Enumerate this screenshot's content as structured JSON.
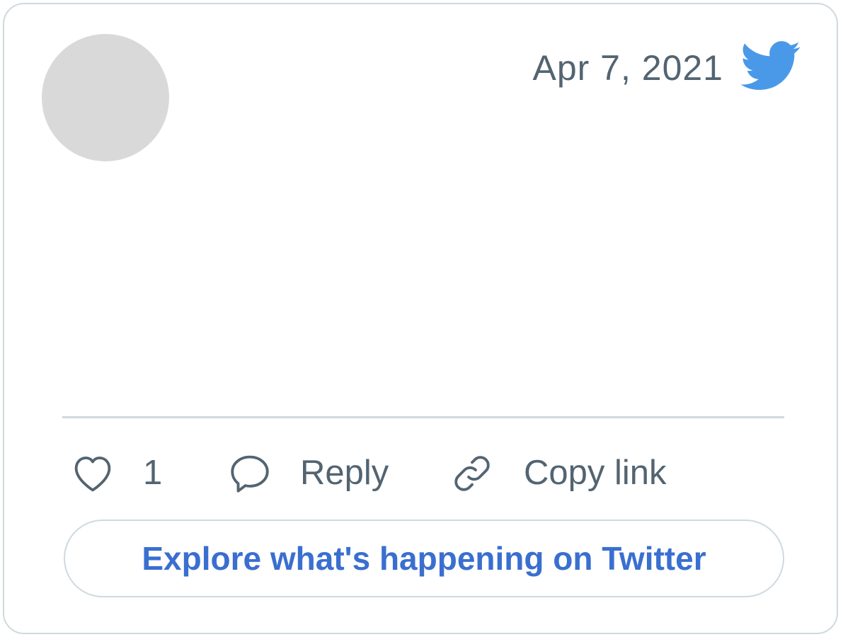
{
  "tweet": {
    "date": "Apr 7, 2021",
    "avatar_color": "#d9d9d9",
    "brand_icon": "twitter-bird-icon",
    "brand_color": "#4a99e9"
  },
  "actions": {
    "like_count": "1",
    "reply_label": "Reply",
    "copy_link_label": "Copy link",
    "icons": [
      "heart-icon",
      "speech-bubble-icon",
      "link-icon"
    ]
  },
  "explore": {
    "label": "Explore what's happening on Twitter",
    "text_color": "#3a6fd0"
  },
  "colors": {
    "muted_text": "#536471",
    "border": "#cfd9de"
  }
}
